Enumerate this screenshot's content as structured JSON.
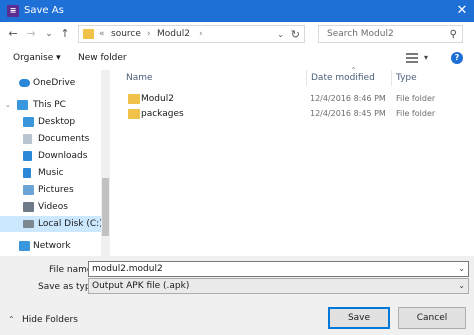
{
  "window": {
    "title": "Save As",
    "app_icon_glyph": "≡",
    "close_glyph": "✕"
  },
  "nav": {
    "back_glyph": "←",
    "forward_glyph": "→",
    "recent_glyph": "⌄",
    "up_glyph": "↑",
    "breadcrumb": {
      "overflow": "«",
      "items": [
        "source",
        "Modul2"
      ],
      "separator": "›"
    },
    "address_dropdown_glyph": "⌄",
    "refresh_glyph": "↻",
    "search_placeholder": "Search Modul2",
    "search_glyph": "⚲"
  },
  "toolbar": {
    "organise_label": "Organise ▾",
    "new_folder_label": "New folder",
    "view_dropdown_glyph": "▾",
    "help_glyph": "?"
  },
  "sidebar": {
    "items": [
      {
        "label": "OneDrive",
        "icon": "cloud-icon",
        "expander": ""
      },
      {
        "label": "This PC",
        "icon": "monitor-icon",
        "expander": "⌄"
      },
      {
        "label": "Desktop",
        "icon": "desktop-icon",
        "expander": ""
      },
      {
        "label": "Documents",
        "icon": "documents-icon",
        "expander": ""
      },
      {
        "label": "Downloads",
        "icon": "download-icon",
        "expander": ""
      },
      {
        "label": "Music",
        "icon": "music-icon",
        "expander": ""
      },
      {
        "label": "Pictures",
        "icon": "pictures-icon",
        "expander": ""
      },
      {
        "label": "Videos",
        "icon": "videos-icon",
        "expander": ""
      },
      {
        "label": "Local Disk (C:)",
        "icon": "drive-icon",
        "expander": ""
      },
      {
        "label": "Network",
        "icon": "network-icon",
        "expander": ""
      }
    ]
  },
  "files": {
    "columns": {
      "name": "Name",
      "date": "Date modified",
      "type": "Type"
    },
    "rows": [
      {
        "name": "Modul2",
        "date": "12/4/2016 8:46 PM",
        "type": "File folder"
      },
      {
        "name": "packages",
        "date": "12/4/2016 8:45 PM",
        "type": "File folder"
      }
    ]
  },
  "form": {
    "filename_label": "File name:",
    "filename_value": "modul2.modul2",
    "savetype_label": "Save as type:",
    "savetype_value": "Output APK file (.apk)",
    "dropdown_glyph": "⌄",
    "hide_folders_label": "Hide Folders",
    "hide_folders_glyph": "⌃",
    "save_label": "Save",
    "cancel_label": "Cancel"
  },
  "colors": {
    "titlebar": "#1e6fd6",
    "folder": "#f0c24a",
    "selected": "#cce8ff",
    "accent": "#0078d7"
  }
}
